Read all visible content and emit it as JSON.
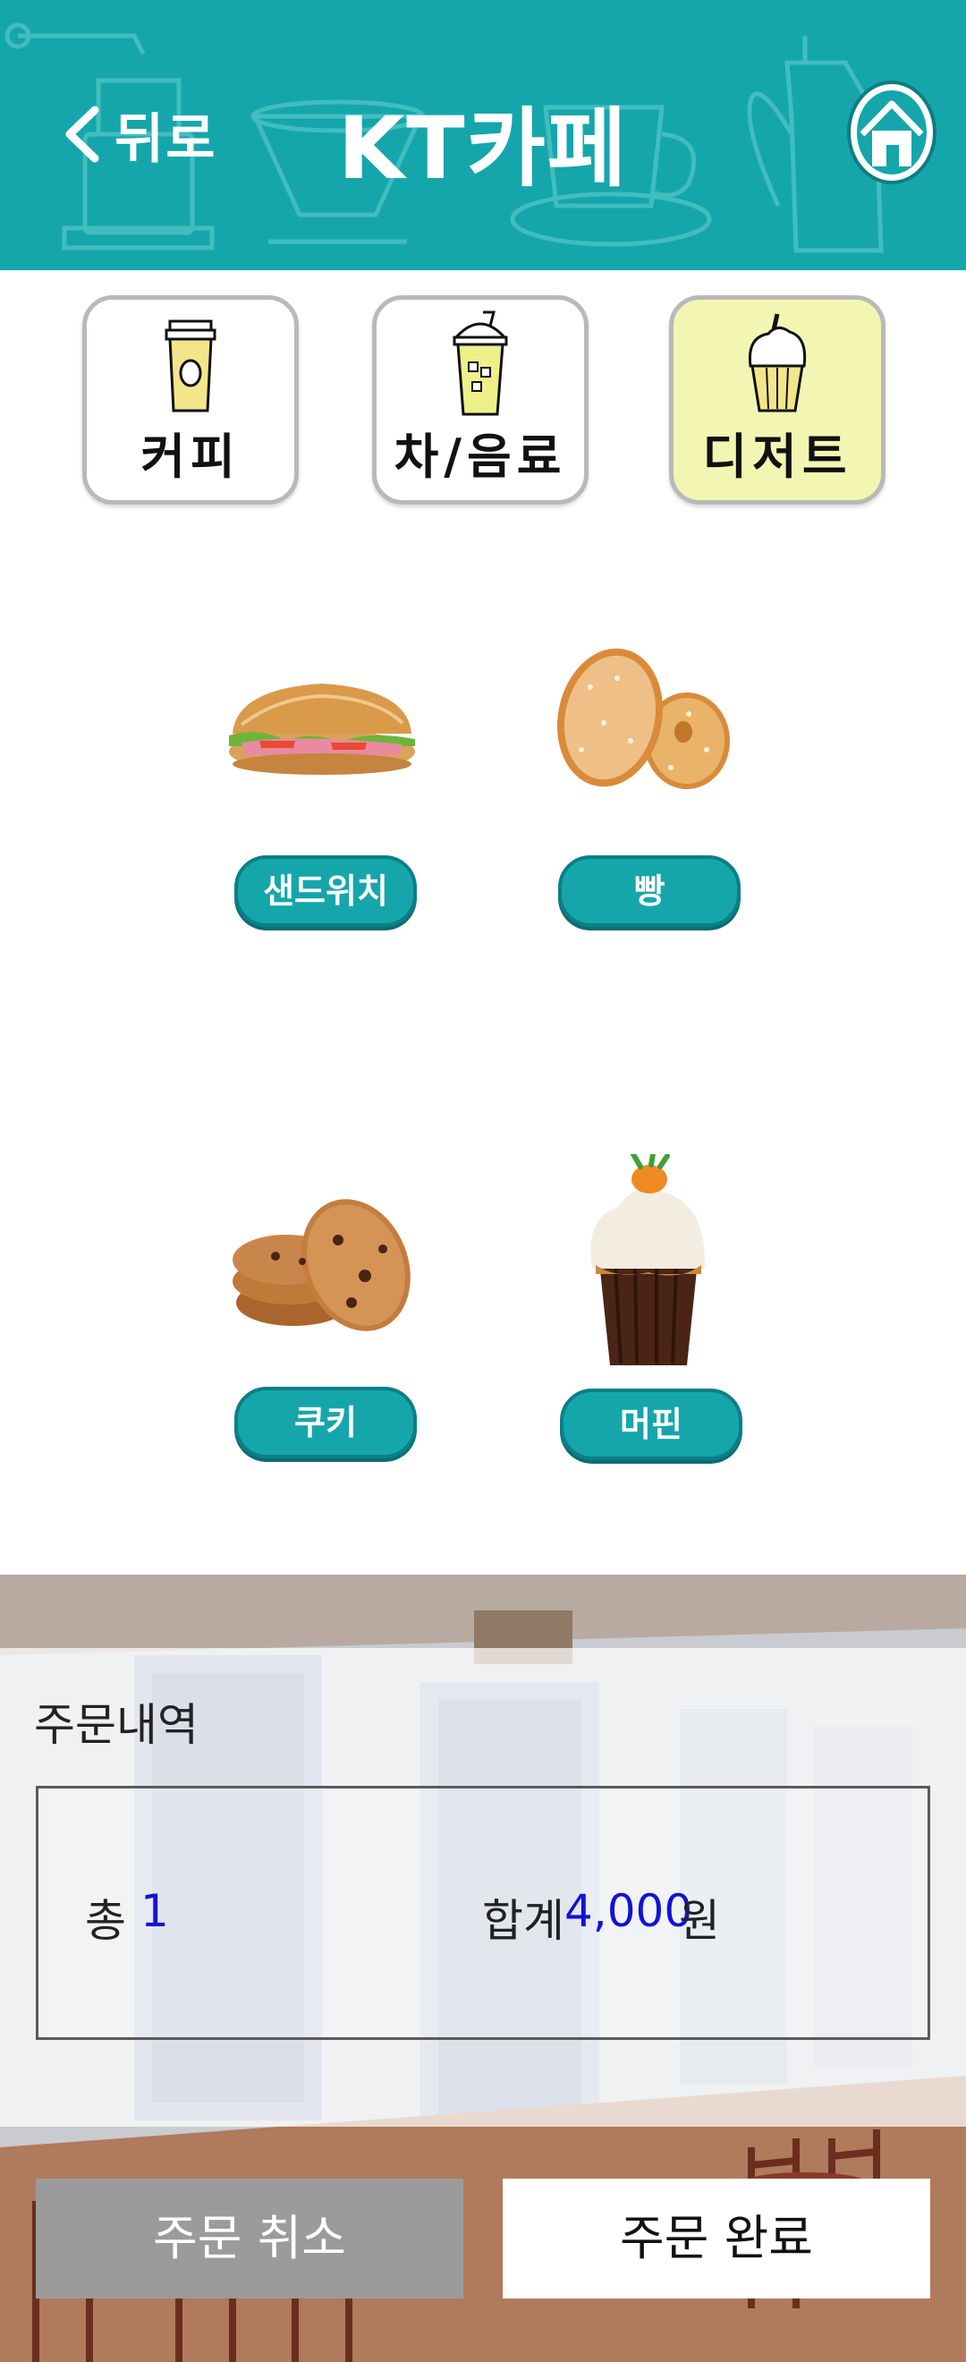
{
  "header": {
    "back_label": "뒤로",
    "title": "KT카페"
  },
  "categories": [
    {
      "label": "커피",
      "icon": "coffee-cup-icon",
      "active": false
    },
    {
      "label": "차/음료",
      "icon": "iced-drink-icon",
      "active": false
    },
    {
      "label": "디저트",
      "icon": "muffin-icon",
      "active": true
    }
  ],
  "products": [
    {
      "label": "샌드위치",
      "image": "sandwich-image"
    },
    {
      "label": "빵",
      "image": "donut-image"
    },
    {
      "label": "쿠키",
      "image": "cookie-image"
    },
    {
      "label": "머핀",
      "image": "cupcake-image"
    }
  ],
  "order": {
    "title": "주문내역",
    "count_label": "총",
    "count_value": "1",
    "total_label": "합계",
    "total_value": "4,000",
    "currency": "원"
  },
  "actions": {
    "cancel_label": "주문 취소",
    "done_label": "주문 완료"
  },
  "colors": {
    "header": "#15a6ab",
    "active_tab": "#f3f6b2",
    "product_button": "#15a6ab",
    "value_text": "#1212d6",
    "cancel_button": "#9b9b9b"
  }
}
